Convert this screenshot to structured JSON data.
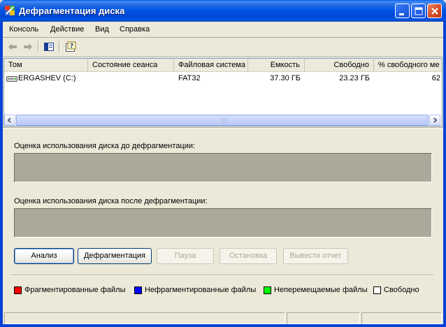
{
  "window": {
    "title": "Дефрагментация диска",
    "colors": {
      "titlebar": "#0055E5",
      "face": "#ECE9D8",
      "graph_bg": "#ABA99A"
    }
  },
  "menu": [
    {
      "label": "Консоль"
    },
    {
      "label": "Действие"
    },
    {
      "label": "Вид"
    },
    {
      "label": "Справка"
    }
  ],
  "toolbar": {
    "icons": [
      "back-arrow-icon",
      "forward-arrow-icon",
      "show-hide-tree-icon",
      "help-icon"
    ]
  },
  "volumes": {
    "columns": [
      "Том",
      "Состояние сеанса",
      "Файловая система",
      "Емкость",
      "Свободно",
      "% свободного ме"
    ],
    "rows": [
      {
        "volume": "ERGASHEV (C:)",
        "session_status": "",
        "file_system": "FAT32",
        "capacity": "37.30 ГБ",
        "free": "23.23 ГБ",
        "percent_free": "62"
      }
    ],
    "scroll_grip": "|||"
  },
  "analysis": {
    "before_label": "Оценка использования диска до дефрагментации:",
    "after_label": "Оценка использования диска после дефрагментации:"
  },
  "buttons": {
    "analyze": "Анализ",
    "defragment": "Дефрагментация",
    "pause": "Пауза",
    "stop": "Остановка",
    "report": "Вывести отчет"
  },
  "legend": [
    {
      "label": "Фрагментированные файлы",
      "color": "#FF0000"
    },
    {
      "label": "Нефрагментированные файлы",
      "color": "#0000FF"
    },
    {
      "label": "Неперемещаемые файлы",
      "color": "#00FF00"
    },
    {
      "label": "Свободно",
      "color": "#FFFFFF"
    }
  ]
}
